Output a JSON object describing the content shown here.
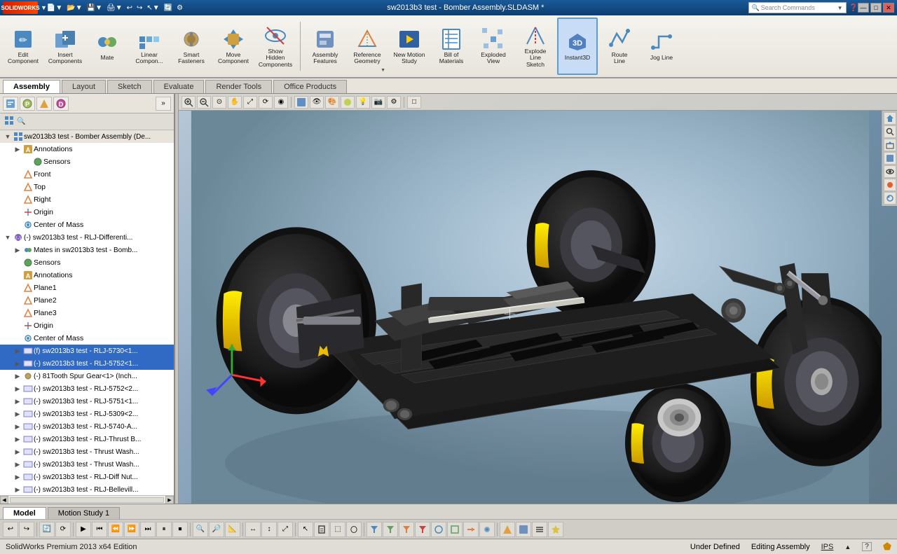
{
  "titlebar": {
    "title": "sw2013b3 test - Bomber Assembly.SLDASM *",
    "search_placeholder": "Search Commands",
    "controls": [
      "—",
      "□",
      "✕"
    ]
  },
  "toolbar": {
    "tools": [
      {
        "id": "edit-component",
        "label": "Edit\nComponent",
        "icon": "✏️"
      },
      {
        "id": "insert-components",
        "label": "Insert\nComponents",
        "icon": "📦"
      },
      {
        "id": "mate",
        "label": "Mate",
        "icon": "🔗"
      },
      {
        "id": "linear-component",
        "label": "Linear\nCompon...",
        "icon": "⊞"
      },
      {
        "id": "smart-fasteners",
        "label": "Smart\nFasteners",
        "icon": "🔩"
      },
      {
        "id": "move-component",
        "label": "Move\nComponent",
        "icon": "↔"
      },
      {
        "id": "show-hidden",
        "label": "Show\nHidden\nComponents",
        "icon": "👁"
      },
      {
        "id": "assembly-features",
        "label": "Assembly\nFeatures",
        "icon": "⚙"
      },
      {
        "id": "reference-geometry",
        "label": "Reference\nGeometry",
        "icon": "△"
      },
      {
        "id": "new-motion-study",
        "label": "New Motion\nStudy",
        "icon": "▶"
      },
      {
        "id": "bill-of-materials",
        "label": "Bill of\nMaterials",
        "icon": "📋"
      },
      {
        "id": "exploded-view",
        "label": "Exploded\nView",
        "icon": "💥"
      },
      {
        "id": "explode-line-sketch",
        "label": "Explode\nLine\nSketch",
        "icon": "✏"
      },
      {
        "id": "instant3d",
        "label": "Instant3D",
        "icon": "3D",
        "active": true
      },
      {
        "id": "route-line",
        "label": "Route\nLine",
        "icon": "↗"
      },
      {
        "id": "jog-line",
        "label": "Jog Line",
        "icon": "⤵"
      }
    ]
  },
  "tabs": [
    "Assembly",
    "Layout",
    "Sketch",
    "Evaluate",
    "Render Tools",
    "Office Products"
  ],
  "active_tab": "Assembly",
  "sidebar": {
    "title": "sw2013b3 test - Bomber Assembly (De...",
    "tree": [
      {
        "id": "annotations-root",
        "label": "Annotations",
        "level": 1,
        "type": "folder",
        "expanded": true,
        "icon": "A"
      },
      {
        "id": "sensors-1",
        "label": "Sensors",
        "level": 2,
        "type": "sensor",
        "icon": "S"
      },
      {
        "id": "front-plane",
        "label": "Front",
        "level": 2,
        "type": "plane",
        "icon": "◇"
      },
      {
        "id": "top-plane",
        "label": "Top",
        "level": 2,
        "type": "plane",
        "icon": "◇"
      },
      {
        "id": "right-plane",
        "label": "Right",
        "level": 2,
        "type": "plane",
        "icon": "◇"
      },
      {
        "id": "origin",
        "label": "Origin",
        "level": 2,
        "type": "origin",
        "icon": "+"
      },
      {
        "id": "center-of-mass",
        "label": "Center of Mass",
        "level": 2,
        "type": "mass",
        "icon": "⊕"
      },
      {
        "id": "differential-asm",
        "label": "(-) sw2013b3 test - RLJ-Differential...",
        "level": 1,
        "type": "assembly",
        "icon": "⚙",
        "expanded": true
      },
      {
        "id": "mates-in",
        "label": "Mates in sw2013b3 test - Bomb...",
        "level": 2,
        "type": "mates",
        "icon": "🔗"
      },
      {
        "id": "sensors-2",
        "label": "Sensors",
        "level": 2,
        "type": "sensor",
        "icon": "S"
      },
      {
        "id": "annotations-2",
        "label": "Annotations",
        "level": 2,
        "type": "folder",
        "icon": "A"
      },
      {
        "id": "plane1",
        "label": "Plane1",
        "level": 2,
        "type": "plane",
        "icon": "◇"
      },
      {
        "id": "plane2",
        "label": "Plane2",
        "level": 2,
        "type": "plane",
        "icon": "◇"
      },
      {
        "id": "plane3",
        "label": "Plane3",
        "level": 2,
        "type": "plane",
        "icon": "◇"
      },
      {
        "id": "origin2",
        "label": "Origin",
        "level": 2,
        "type": "origin",
        "icon": "+"
      },
      {
        "id": "center-of-mass2",
        "label": "Center of Mass",
        "level": 2,
        "type": "mass",
        "icon": "⊕"
      },
      {
        "id": "rlj-5730",
        "label": "(f) sw2013b3 test - RLJ-5730<1...",
        "level": 2,
        "type": "part",
        "icon": "🔧",
        "selected": true
      },
      {
        "id": "rlj-5752",
        "label": "(-) sw2013b3 test - RLJ-5752<1...",
        "level": 2,
        "type": "part",
        "icon": "🔧",
        "selected": true
      },
      {
        "id": "spur-gear",
        "label": "(-) 81Tooth Spur Gear<1> (Inch...",
        "level": 2,
        "type": "part",
        "icon": "⚙"
      },
      {
        "id": "rlj-5752-2",
        "label": "(-) sw2013b3 test - RLJ-5752<2...",
        "level": 2,
        "type": "part",
        "icon": "🔧"
      },
      {
        "id": "rlj-5751",
        "label": "(-) sw2013b3 test - RLJ-5751<1...",
        "level": 2,
        "type": "part",
        "icon": "🔧"
      },
      {
        "id": "rlj-5309",
        "label": "(-) sw2013b3 test - RLJ-5309<2...",
        "level": 2,
        "type": "part",
        "icon": "🔧"
      },
      {
        "id": "rlj-5740",
        "label": "(-) sw2013b3 test - RLJ-5740-A...",
        "level": 2,
        "type": "part",
        "icon": "🔧"
      },
      {
        "id": "rlj-thrust-b",
        "label": "(-) sw2013b3 test - RLJ-Thrust B...",
        "level": 2,
        "type": "part",
        "icon": "🔧"
      },
      {
        "id": "thrust-wash",
        "label": "(-) sw2013b3 test - Thrust Wash...",
        "level": 2,
        "type": "part",
        "icon": "🔧"
      },
      {
        "id": "thrust-wash2",
        "label": "(-) sw2013b3 test - Thrust Wash...",
        "level": 2,
        "type": "part",
        "icon": "🔧"
      },
      {
        "id": "diff-nut",
        "label": "(-) sw2013b3 test - RLJ-Diff Nut...",
        "level": 2,
        "type": "part",
        "icon": "🔧"
      },
      {
        "id": "bellevill",
        "label": "(-) sw2013b3 test - RLJ-Bellevill...",
        "level": 2,
        "type": "part",
        "icon": "🔧"
      }
    ]
  },
  "viewport_toolbar": {
    "buttons": [
      "🔍+",
      "🔍-",
      "⊙",
      "↔",
      "⤢",
      "⟳",
      "◉",
      "🎨",
      "⚙",
      "□"
    ]
  },
  "right_icons": [
    "🏠",
    "🔎",
    "📷",
    "⚙",
    "🎨",
    "💡",
    "🔵"
  ],
  "bottom_tabs": [
    "Model",
    "Motion Study 1"
  ],
  "active_bottom_tab": "Model",
  "statusbar": {
    "left": "SolidWorks Premium 2013 x64 Edition",
    "status": "Under Defined",
    "mode": "Editing Assembly",
    "units": "IPS"
  },
  "bottom_toolbar": {
    "buttons": [
      "⟲",
      "⟳",
      "|",
      "▶",
      "⏮",
      "⏭",
      "⏪",
      "⏩",
      "⏸",
      "⏹",
      "|",
      "🔍",
      "🔎",
      "📐",
      "|",
      "↔",
      "↕",
      "⤢",
      "|",
      "✏",
      "△",
      "◉",
      "⚙",
      "|",
      "🔧",
      "📋",
      "🔗",
      "⊞"
    ]
  }
}
